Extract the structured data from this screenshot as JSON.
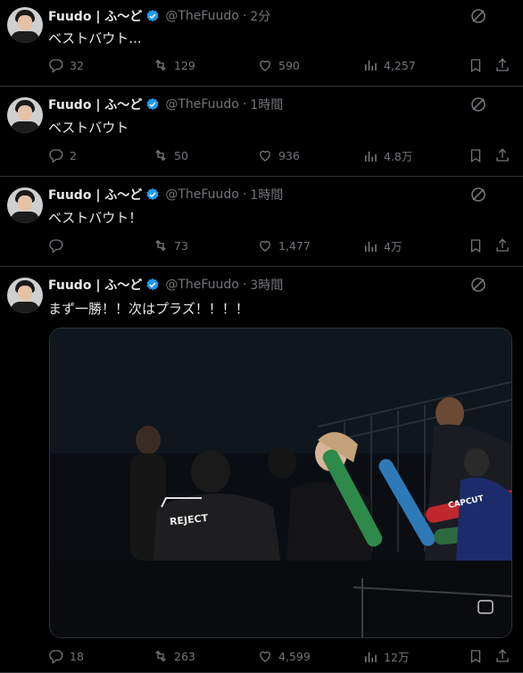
{
  "tweets": [
    {
      "name": "Fuudo | ふ〜ど",
      "handle": "@TheFuudo",
      "time": "2分",
      "text": "ベストバウト...",
      "replies": "32",
      "reposts": "129",
      "likes": "590",
      "views": "4,257"
    },
    {
      "name": "Fuudo | ふ〜ど",
      "handle": "@TheFuudo",
      "time": "1時間",
      "text": "ベストバウト",
      "replies": "2",
      "reposts": "50",
      "likes": "936",
      "views": "4.8万"
    },
    {
      "name": "Fuudo | ふ〜ど",
      "handle": "@TheFuudo",
      "time": "1時間",
      "text": "ベストバウト！",
      "replies": "",
      "reposts": "73",
      "likes": "1,477",
      "views": "4万"
    },
    {
      "name": "Fuudo | ふ〜ど",
      "handle": "@TheFuudo",
      "time": "3時間",
      "text": "まず一勝！！次はプラズ！！！！",
      "replies": "18",
      "reposts": "263",
      "likes": "4,599",
      "views": "12万"
    }
  ],
  "colors": {
    "background": "#000000",
    "text": "#e7e9ea",
    "muted": "#71767b",
    "verified": "#1d9bf0",
    "divider": "#2f3336"
  },
  "media": {
    "jersey_text": "REJECT",
    "banner_text": "CAPCUT"
  }
}
